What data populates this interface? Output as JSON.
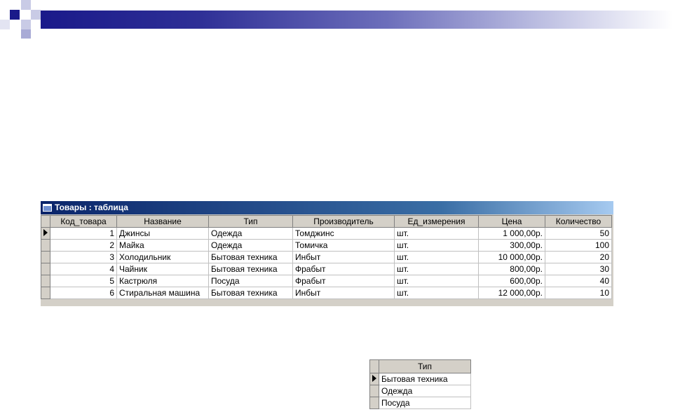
{
  "window": {
    "title": "Товары : таблица",
    "columns": [
      "Код_товара",
      "Название",
      "Тип",
      "Производитель",
      "Ед_измерения",
      "Цена",
      "Количество"
    ],
    "rows": [
      {
        "code": "1",
        "name": "Джинсы",
        "type": "Одежда",
        "maker": "Томджинс",
        "unit": "шт.",
        "price": "1 000,00р.",
        "qty": "50"
      },
      {
        "code": "2",
        "name": "Майка",
        "type": "Одежда",
        "maker": "Томичка",
        "unit": "шт.",
        "price": "300,00р.",
        "qty": "100"
      },
      {
        "code": "3",
        "name": "Холодильник",
        "type": "Бытовая техника",
        "maker": "Инбыт",
        "unit": "шт.",
        "price": "10 000,00р.",
        "qty": "20"
      },
      {
        "code": "4",
        "name": "Чайник",
        "type": "Бытовая техника",
        "maker": "Фрабыт",
        "unit": "шт.",
        "price": "800,00р.",
        "qty": "30"
      },
      {
        "code": "5",
        "name": "Кастрюля",
        "type": "Посуда",
        "maker": "Фрабыт",
        "unit": "шт.",
        "price": "600,00р.",
        "qty": "40"
      },
      {
        "code": "6",
        "name": "Стиральная машина",
        "type": "Бытовая техника",
        "maker": "Инбыт",
        "unit": "шт.",
        "price": "12 000,00р.",
        "qty": "10"
      }
    ]
  },
  "lookup": {
    "column": "Тип",
    "rows": [
      "Бытовая техника",
      "Одежда",
      "Посуда"
    ]
  }
}
